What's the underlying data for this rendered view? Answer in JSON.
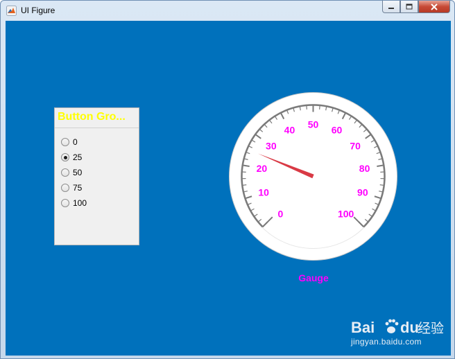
{
  "window": {
    "title": "UI Figure",
    "background": "#0071bc"
  },
  "button_group": {
    "title": "Button Gro...",
    "title_color": "#ffff00",
    "options": [
      {
        "label": "0",
        "selected": false
      },
      {
        "label": "25",
        "selected": true
      },
      {
        "label": "50",
        "selected": false
      },
      {
        "label": "75",
        "selected": false
      },
      {
        "label": "100",
        "selected": false
      }
    ]
  },
  "gauge": {
    "label": "Gauge",
    "label_color": "#ff00ff",
    "tick_label_color": "#ff00ff",
    "needle_color": "#d93a45",
    "limits": [
      0,
      100
    ],
    "major_ticks": [
      "0",
      "10",
      "20",
      "30",
      "40",
      "50",
      "60",
      "70",
      "80",
      "90",
      "100"
    ],
    "value": 25
  },
  "watermark": {
    "logo_text": "Bai",
    "logo_text_2": "du",
    "logo_suffix": "经验",
    "url": "jingyan.baidu.com"
  }
}
